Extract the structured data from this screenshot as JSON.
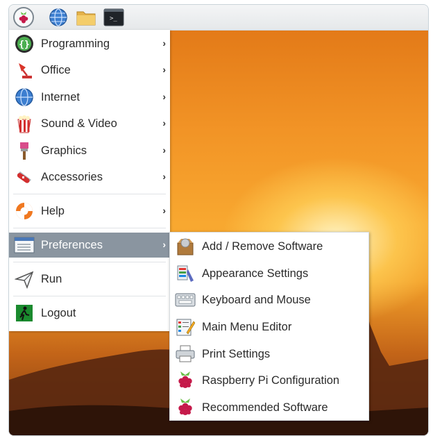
{
  "main_menu": {
    "items": [
      {
        "label": "Programming",
        "icon": "code-braces-icon"
      },
      {
        "label": "Office",
        "icon": "office-lamp-icon"
      },
      {
        "label": "Internet",
        "icon": "globe-icon"
      },
      {
        "label": "Sound & Video",
        "icon": "popcorn-icon"
      },
      {
        "label": "Graphics",
        "icon": "paintbrush-icon"
      },
      {
        "label": "Accessories",
        "icon": "swiss-knife-icon"
      },
      {
        "label": "Help",
        "icon": "lifebuoy-icon"
      },
      {
        "label": "Preferences",
        "icon": "control-panel-icon",
        "active": true
      },
      {
        "label": "Run",
        "icon": "paper-plane-icon"
      },
      {
        "label": "Logout",
        "icon": "exit-icon"
      }
    ],
    "arrow": "›"
  },
  "preferences_submenu": {
    "items": [
      {
        "label": "Add / Remove Software",
        "icon": "package-icon"
      },
      {
        "label": "Appearance Settings",
        "icon": "appearance-icon"
      },
      {
        "label": "Keyboard and Mouse",
        "icon": "keyboard-icon"
      },
      {
        "label": "Main Menu Editor",
        "icon": "menu-editor-icon"
      },
      {
        "label": "Print Settings",
        "icon": "printer-icon"
      },
      {
        "label": "Raspberry Pi Configuration",
        "icon": "raspberry-icon"
      },
      {
        "label": "Recommended Software",
        "icon": "raspberry-icon"
      }
    ]
  },
  "taskbar": {
    "terminal_prompt": ">_"
  },
  "colors": {
    "highlight": "#8a95a0",
    "raspberry": "#c51a4a",
    "leaf": "#6cc04a"
  }
}
